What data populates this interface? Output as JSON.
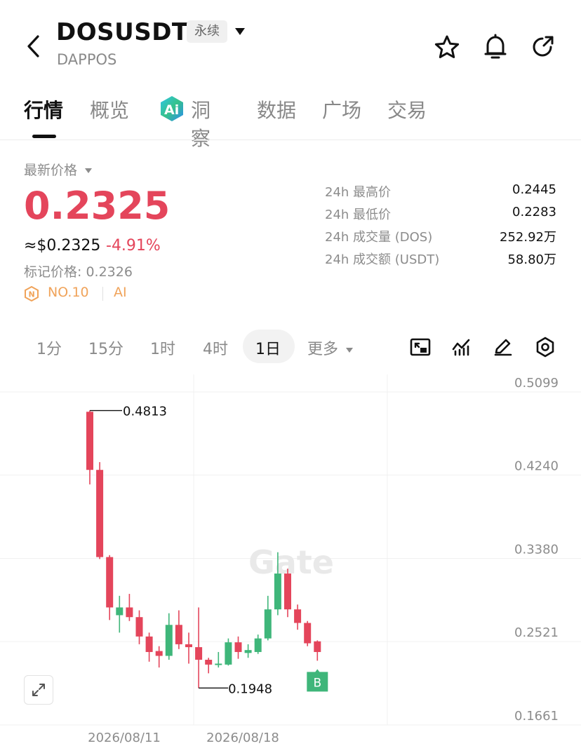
{
  "header": {
    "back_icon": "chevron-left-icon",
    "symbol": "DOSUSDT",
    "contract_tag": "永续",
    "project": "DAPPOS",
    "actions": [
      "star-icon",
      "bell-icon",
      "share-icon"
    ]
  },
  "tabs": [
    {
      "label": "行情",
      "active": true
    },
    {
      "label": "概览"
    },
    {
      "label": "洞察",
      "icon": "ai-logo-icon"
    },
    {
      "label": "数据"
    },
    {
      "label": "广场"
    },
    {
      "label": "交易"
    }
  ],
  "price": {
    "label": "最新价格",
    "last": "0.2325",
    "usd": "≈$0.2325",
    "change": "-4.91%",
    "mark": "标记价格: 0.2326",
    "rank": "NO.10",
    "tag": "AI"
  },
  "stats": [
    {
      "label": "24h 最高价",
      "value": "0.2445"
    },
    {
      "label": "24h 最低价",
      "value": "0.2283"
    },
    {
      "label": "24h 成交量 (DOS)",
      "value": "252.92万"
    },
    {
      "label": "24h 成交额 (USDT)",
      "value": "58.80万"
    }
  ],
  "intervals": {
    "items": [
      "1分",
      "15分",
      "1时",
      "4时",
      "1日",
      "更多"
    ],
    "active": "1日"
  },
  "tools": [
    "chart-type-icon",
    "indicator-icon",
    "draw-pen-icon",
    "settings-hex-icon"
  ],
  "chart_data": {
    "type": "candlestick",
    "price_axis": [
      "0.5099",
      "0.4240",
      "0.3380",
      "0.2521",
      "0.1661"
    ],
    "ylim": [
      0.1661,
      0.5099
    ],
    "date_labels": [
      "2026/08/11",
      "2026/08/18"
    ],
    "high_marker": "0.4813",
    "low_marker": "0.1948",
    "buy_marker": "B",
    "watermark": "Gate",
    "up_color": "#3fb67a",
    "down_color": "#e4455b",
    "candles": [
      {
        "o": 0.48,
        "h": 0.4813,
        "l": 0.405,
        "c": 0.42
      },
      {
        "o": 0.42,
        "h": 0.428,
        "l": 0.328,
        "c": 0.33
      },
      {
        "o": 0.33,
        "h": 0.332,
        "l": 0.265,
        "c": 0.278
      },
      {
        "o": 0.27,
        "h": 0.29,
        "l": 0.252,
        "c": 0.278
      },
      {
        "o": 0.278,
        "h": 0.292,
        "l": 0.264,
        "c": 0.268
      },
      {
        "o": 0.268,
        "h": 0.275,
        "l": 0.24,
        "c": 0.248
      },
      {
        "o": 0.248,
        "h": 0.252,
        "l": 0.222,
        "c": 0.232
      },
      {
        "o": 0.233,
        "h": 0.238,
        "l": 0.216,
        "c": 0.228
      },
      {
        "o": 0.228,
        "h": 0.272,
        "l": 0.224,
        "c": 0.26
      },
      {
        "o": 0.26,
        "h": 0.275,
        "l": 0.235,
        "c": 0.24
      },
      {
        "o": 0.24,
        "h": 0.252,
        "l": 0.22,
        "c": 0.237
      },
      {
        "o": 0.237,
        "h": 0.278,
        "l": 0.1948,
        "c": 0.224
      },
      {
        "o": 0.224,
        "h": 0.226,
        "l": 0.21,
        "c": 0.219
      },
      {
        "o": 0.219,
        "h": 0.232,
        "l": 0.216,
        "c": 0.22
      },
      {
        "o": 0.219,
        "h": 0.246,
        "l": 0.218,
        "c": 0.242
      },
      {
        "o": 0.242,
        "h": 0.248,
        "l": 0.225,
        "c": 0.232
      },
      {
        "o": 0.231,
        "h": 0.24,
        "l": 0.226,
        "c": 0.234
      },
      {
        "o": 0.232,
        "h": 0.25,
        "l": 0.23,
        "c": 0.246
      },
      {
        "o": 0.246,
        "h": 0.29,
        "l": 0.244,
        "c": 0.276
      },
      {
        "o": 0.276,
        "h": 0.335,
        "l": 0.27,
        "c": 0.313
      },
      {
        "o": 0.313,
        "h": 0.318,
        "l": 0.268,
        "c": 0.276
      },
      {
        "o": 0.276,
        "h": 0.281,
        "l": 0.255,
        "c": 0.262
      },
      {
        "o": 0.262,
        "h": 0.264,
        "l": 0.238,
        "c": 0.241
      },
      {
        "o": 0.243,
        "h": 0.244,
        "l": 0.223,
        "c": 0.232
      }
    ]
  }
}
